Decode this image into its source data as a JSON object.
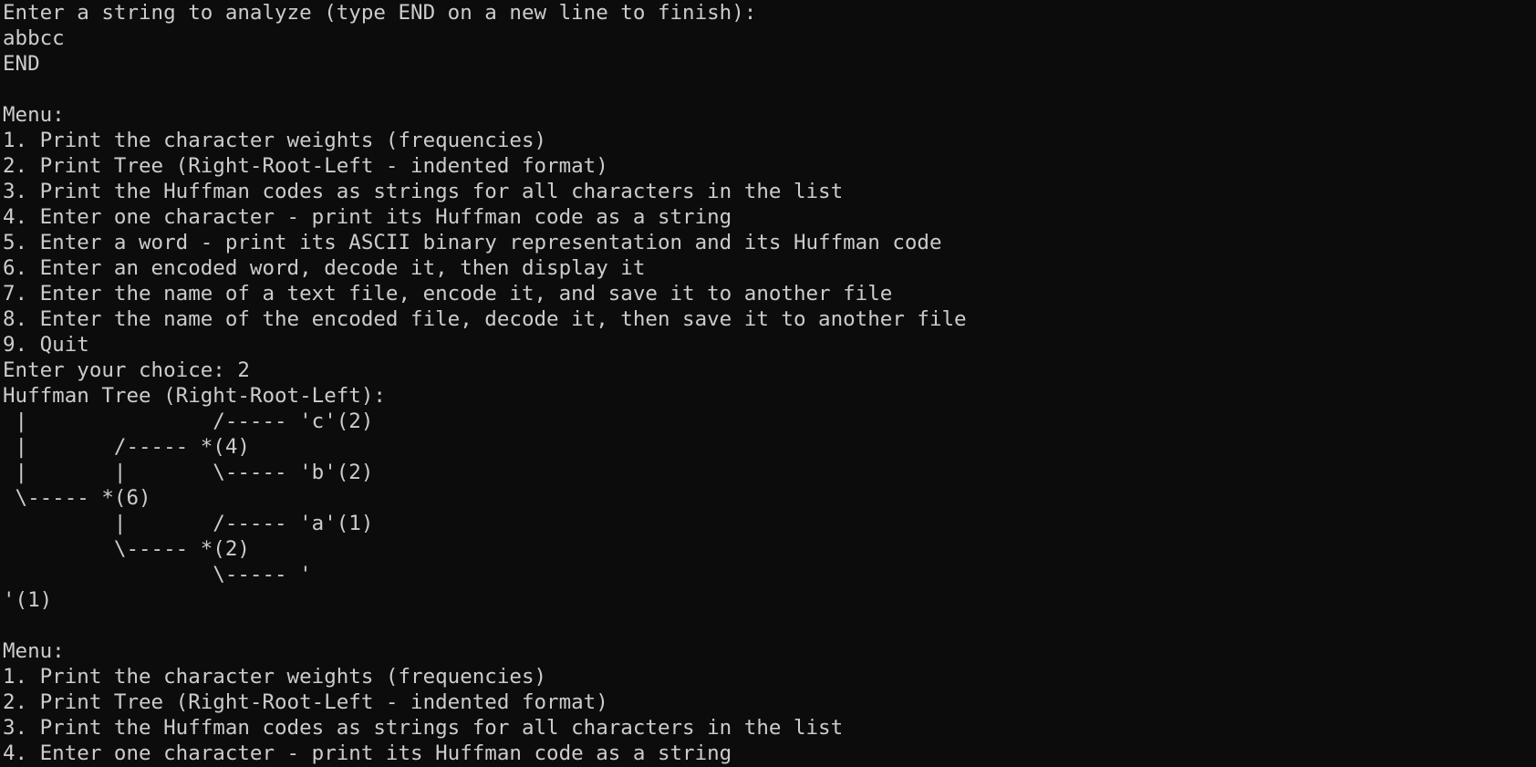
{
  "terminal": {
    "lines": [
      "Enter a string to analyze (type END on a new line to finish):",
      "abbcc",
      "END",
      "",
      "Menu:",
      "1. Print the character weights (frequencies)",
      "2. Print Tree (Right-Root-Left - indented format)",
      "3. Print the Huffman codes as strings for all characters in the list",
      "4. Enter one character - print its Huffman code as a string",
      "5. Enter a word - print its ASCII binary representation and its Huffman code",
      "6. Enter an encoded word, decode it, then display it",
      "7. Enter the name of a text file, encode it, and save it to another file",
      "8. Enter the name of the encoded file, decode it, then save it to another file",
      "9. Quit",
      "Enter your choice: 2",
      "Huffman Tree (Right-Root-Left):",
      " |               /----- 'c'(2)",
      " |       /----- *(4)",
      " |       |       \\----- 'b'(2)",
      " \\----- *(6)",
      "         |       /----- 'a'(1)",
      "         \\----- *(2)",
      "                 \\----- '",
      "'(1)",
      "",
      "Menu:",
      "1. Print the character weights (frequencies)",
      "2. Print Tree (Right-Root-Left - indented format)",
      "3. Print the Huffman codes as strings for all characters in the list",
      "4. Enter one character - print its Huffman code as a string"
    ]
  }
}
